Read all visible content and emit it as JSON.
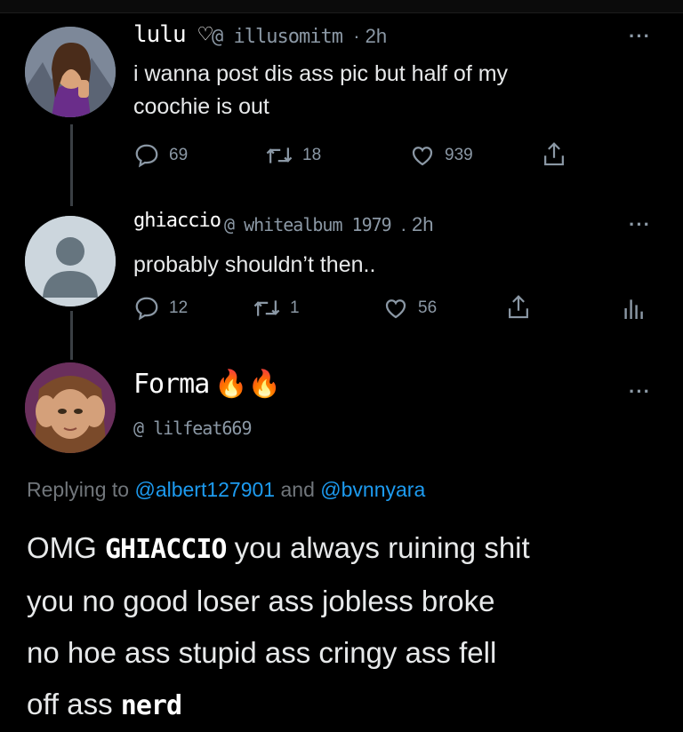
{
  "tweet1": {
    "name": "lulu ♡",
    "handle": "@ illusomitm",
    "time": "· 2h",
    "text_line1": "i wanna post dis ass pic but half of my",
    "text_line2": "coochie is out",
    "replies": "69",
    "retweets": "18",
    "likes": "939"
  },
  "tweet2": {
    "name": "ghiaccio",
    "handle": "@ whitealbum 1979",
    "time": ". 2h",
    "text": "probably shouldn’t then..",
    "replies": "12",
    "retweets": "1",
    "likes": "56"
  },
  "tweet3": {
    "name": "Forma",
    "name_emoji": "🔥🔥",
    "handle": "@ lilfeat669",
    "replying_prefix": "Replying to",
    "mention1": "@albert127901",
    "and_word": "and",
    "mention2": "@bvnnyara",
    "line1_a": "OMG",
    "line1_hl": "GHIACCIO",
    "line1_b": "you always ruining shit",
    "line2": "you no good loser ass jobless broke",
    "line3": "no hoe ass stupid ass cringy ass fell",
    "line4_a": "off ass",
    "line4_hl": "nerd"
  },
  "more_label": "···",
  "icons": [
    "reply-icon",
    "retweet-icon",
    "like-icon",
    "share-icon",
    "analytics-icon",
    "more-icon"
  ]
}
